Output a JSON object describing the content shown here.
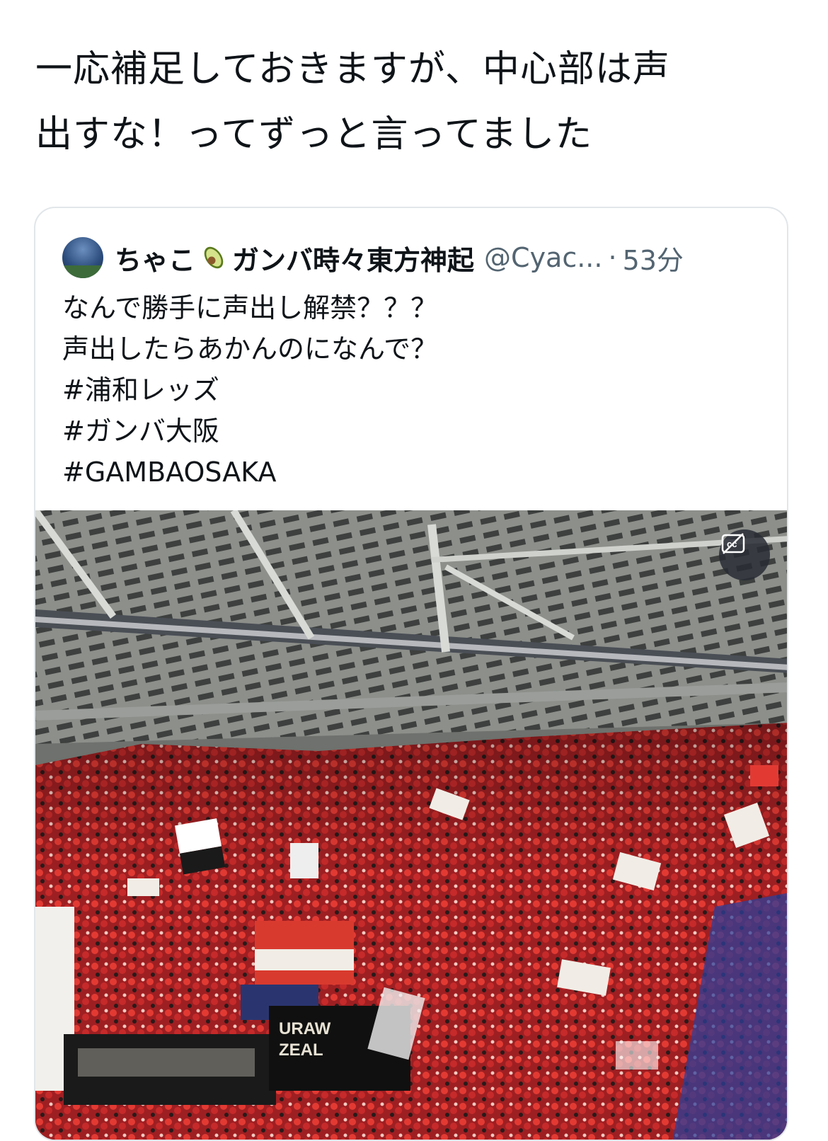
{
  "tweet": {
    "text": "一応補足しておきますが、中心部は声\n出すな！ってずっと言ってました"
  },
  "quote": {
    "author_name_part1": "ちゃこ",
    "emoji_icon": "avocado-icon",
    "author_name_part2": "ガンバ時々東方神起",
    "handle": "@Cyac...",
    "separator": "·",
    "time": "53分",
    "text": "なんで勝手に声出し解禁？？？\n声出したらあかんのになんで？\n#浦和レッズ\n#ガンバ大阪\n#GAMBAOSAKA",
    "media": {
      "type": "video",
      "banner_text_1": "URAW",
      "banner_text_2": "ZEAL"
    },
    "cc_icon": "closed-captions-off-icon"
  }
}
